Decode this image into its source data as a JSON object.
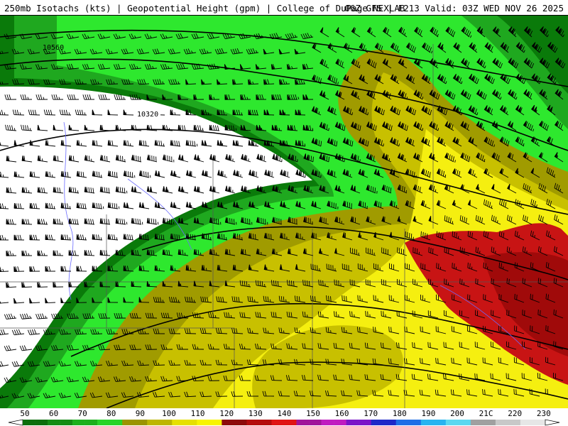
{
  "header": {
    "left_title": "250mb Isotachs (kts) | Geopotential Height (gpm) | College of DuPage NEXLAB",
    "right_title": "06Z GFS | F213 Valid: 03Z WED NOV 26 2025"
  },
  "map": {
    "contour_labels": [
      "10560",
      "10320"
    ],
    "fill_colors": {
      "white": "#ffffff",
      "green_dark": "#0a7a0a",
      "green": "#1fa81f",
      "green_light": "#2ee82e",
      "olive": "#a09b00",
      "olive_light": "#c8c000",
      "yellow": "#f5ef10",
      "red": "#c81414",
      "red_dark": "#a00a0a"
    }
  },
  "colorbar": {
    "labels": [
      "50",
      "60",
      "70",
      "80",
      "90",
      "100",
      "110",
      "120",
      "130",
      "140",
      "150",
      "160",
      "170",
      "180",
      "190",
      "200",
      "21C",
      "220",
      "230"
    ],
    "colors": [
      "#0c6e0c",
      "#148c14",
      "#1cb01c",
      "#28d428",
      "#9a9400",
      "#bdb600",
      "#e6e000",
      "#f8f400",
      "#8c0a0a",
      "#b40c0c",
      "#e01414",
      "#a0149a",
      "#c01cc0",
      "#7a14c8",
      "#1e28c8",
      "#1e6ee6",
      "#28b4f0",
      "#5ad8f0",
      "#a0a0a0",
      "#c8c8c8",
      "#e6e6e6"
    ]
  }
}
